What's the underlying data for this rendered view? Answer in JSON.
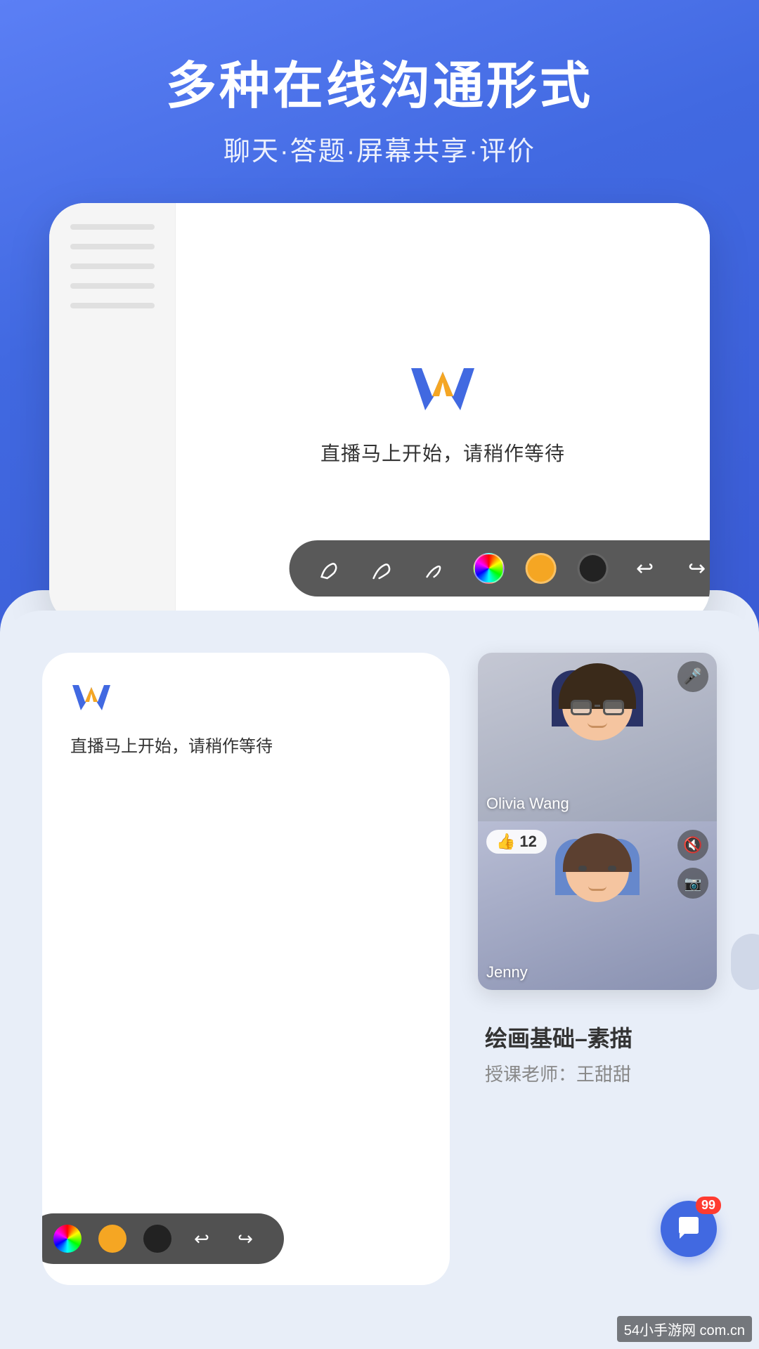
{
  "header": {
    "title": "多种在线沟通形式",
    "subtitle": "聊天·答题·屏幕共享·评价"
  },
  "device_top": {
    "logo_text": "W",
    "waiting_text": "直播马上开始，请稍作等待",
    "toolbar": {
      "colors": [
        "rainbow",
        "orange",
        "black"
      ],
      "undo_label": "↩",
      "redo_label": "↪"
    }
  },
  "device_bottom": {
    "waiting_text": "直播马上开始，请稍作等待",
    "video_cards": [
      {
        "name": "Olivia Wang",
        "has_mic": true,
        "mic_on": true
      },
      {
        "name": "Jenny",
        "like_count": "12",
        "mic_muted": true,
        "camera_off": true
      }
    ],
    "course_title": "绘画基础–素描",
    "teacher_label": "授课老师：王甜甜",
    "chat_badge": "99",
    "toolbar": {
      "colors": [
        "rainbow",
        "orange",
        "black"
      ],
      "undo_label": "↩",
      "redo_label": "↪"
    }
  },
  "watermark": "54小手游网 com.cn"
}
